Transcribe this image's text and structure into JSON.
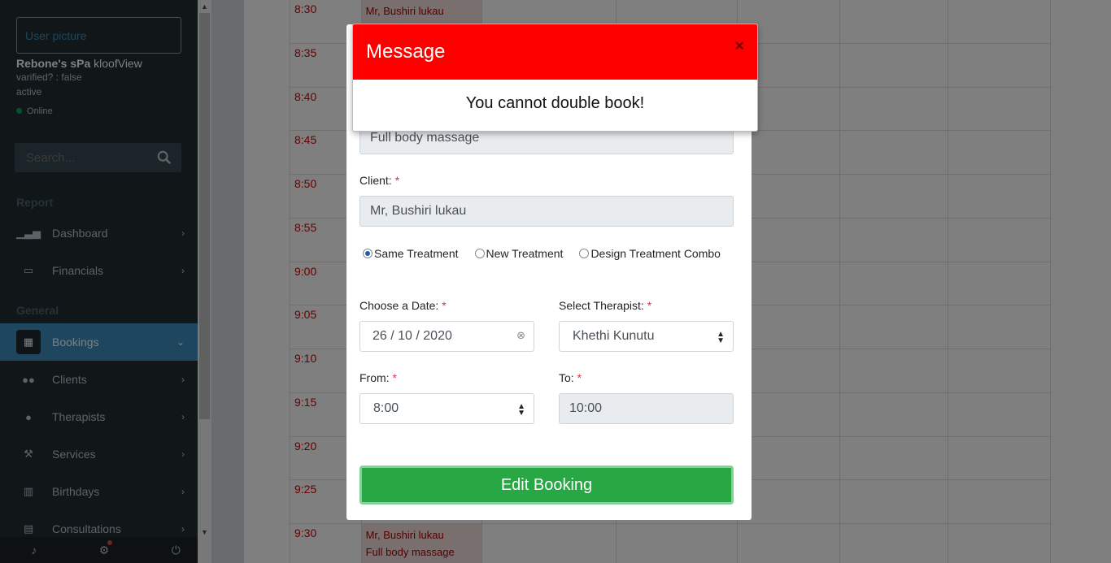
{
  "sidebar": {
    "user_picture_placeholder": "User picture",
    "business_name": "Rebone's sPa",
    "location": "kloofView",
    "verified": "varified? : false",
    "status": "active",
    "online": "Online",
    "search_placeholder": "Search...",
    "sections": {
      "report": "Report",
      "general": "General"
    },
    "items": [
      {
        "label": "Dashboard",
        "icon": "chart-bars-icon"
      },
      {
        "label": "Financials",
        "icon": "money-icon"
      },
      {
        "label": "Bookings",
        "icon": "calendar-icon"
      },
      {
        "label": "Clients",
        "icon": "users-icon"
      },
      {
        "label": "Therapists",
        "icon": "user-icon"
      },
      {
        "label": "Services",
        "icon": "wrench-icon"
      },
      {
        "label": "Birthdays",
        "icon": "cake-icon"
      },
      {
        "label": "Consultations",
        "icon": "clipboard-icon"
      }
    ]
  },
  "schedule": {
    "times": [
      "8:30",
      "8:35",
      "8:40",
      "8:45",
      "8:50",
      "8:55",
      "9:00",
      "9:05",
      "9:10",
      "9:15",
      "9:20",
      "9:25",
      "9:30"
    ],
    "booking_top": "Mr, Bushiri lukau",
    "booking_top_service": "Full body massage",
    "booking_bottom": "Mr, Bushiri lukau",
    "booking_bottom_service": "Full body massage"
  },
  "booking_form": {
    "service_value": "Full body massage",
    "client_label": "Client:",
    "client_value": "Mr, Bushiri lukau",
    "radio_same": "Same Treatment",
    "radio_new": "New Treatment",
    "radio_combo": "Design Treatment Combo",
    "date_label": "Choose a Date:",
    "date_value": "26 / 10 / 2020",
    "therapist_label": "Select Therapist:",
    "therapist_value": "Khethi Kunutu",
    "from_label": "From:",
    "from_value": "8:00",
    "to_label": "To:",
    "to_value": "10:00",
    "required_mark": "*",
    "submit_label": "Edit Booking"
  },
  "message": {
    "title": "Message",
    "close": "×",
    "body": "You cannot double book!"
  },
  "colors": {
    "message_header": "#ff0000",
    "submit_button": "#28a745",
    "sidebar_bg": "#222d32",
    "active_item": "#3c8dbc"
  }
}
